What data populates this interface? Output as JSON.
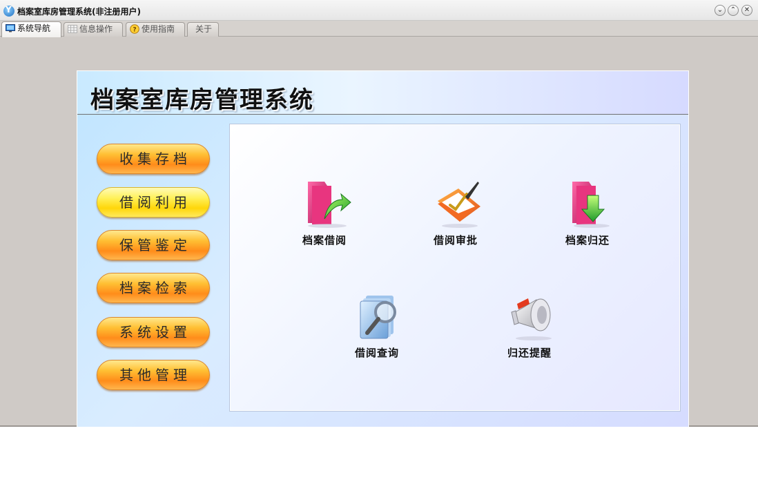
{
  "window": {
    "title": "档案室库房管理系统(非注册用户)",
    "controls": {
      "minimize": "⌄",
      "maximize": "⌃",
      "close": "✕"
    }
  },
  "tabs": [
    {
      "label": "系统导航",
      "icon": "monitor-icon",
      "active": true
    },
    {
      "label": "信息操作",
      "icon": "grid-icon",
      "active": false
    },
    {
      "label": "使用指南",
      "icon": "help-icon",
      "active": false
    },
    {
      "label": "关于",
      "icon": "",
      "active": false
    }
  ],
  "header": {
    "title": "档案室库房管理系统"
  },
  "menu": [
    {
      "label": "收集存档",
      "selected": false
    },
    {
      "label": "借阅利用",
      "selected": true
    },
    {
      "label": "保管鉴定",
      "selected": false
    },
    {
      "label": "档案检索",
      "selected": false
    },
    {
      "label": "系统设置",
      "selected": false
    },
    {
      "label": "其他管理",
      "selected": false
    }
  ],
  "features": [
    {
      "label": "档案借阅",
      "icon": "folder-arrow-icon"
    },
    {
      "label": "借阅审批",
      "icon": "approve-folder-icon"
    },
    {
      "label": "档案归还",
      "icon": "folder-return-icon"
    },
    {
      "label": "借阅查询",
      "icon": "document-search-icon"
    },
    {
      "label": "归还提醒",
      "icon": "megaphone-icon"
    }
  ],
  "colors": {
    "menu_orange": "#ff8c1a",
    "menu_selected_yellow": "#fff15a",
    "panel_blue": "#d9ecff"
  }
}
